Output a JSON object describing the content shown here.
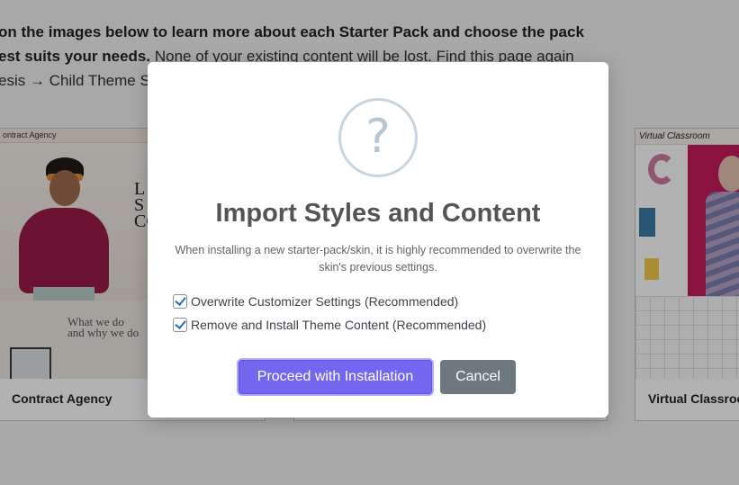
{
  "background": {
    "intro_line1": "on the images below to learn more about each Starter Pack and choose the pack",
    "intro_line2_bold": "est suits your needs.",
    "intro_line2_rest": " None of your existing content will be lost. Find this page again",
    "intro_line3": "esis → Child Theme S",
    "cards": [
      {
        "title": "Contract Agency",
        "header": "ontract Agency",
        "hero": "L\nS\nCO",
        "lower": "What we do\nand why we do"
      },
      {
        "title": ""
      },
      {
        "title": "Virtual Classroo",
        "header": "Virtual Classroom"
      }
    ]
  },
  "modal": {
    "icon": "question-icon",
    "icon_glyph": "?",
    "title": "Import Styles and Content",
    "description": "When installing a new starter-pack/skin, it is highly recommended to overwrite the skin's previous settings.",
    "options": [
      {
        "label": "Overwrite Customizer Settings (Recommended)",
        "checked": true
      },
      {
        "label": "Remove and Install Theme Content (Recommended)",
        "checked": true
      }
    ],
    "proceed_label": "Proceed with Installation",
    "cancel_label": "Cancel"
  },
  "colors": {
    "accent": "#7367f0",
    "cancel": "#6e7881",
    "overlay": "rgba(0,0,0,0.30)"
  }
}
